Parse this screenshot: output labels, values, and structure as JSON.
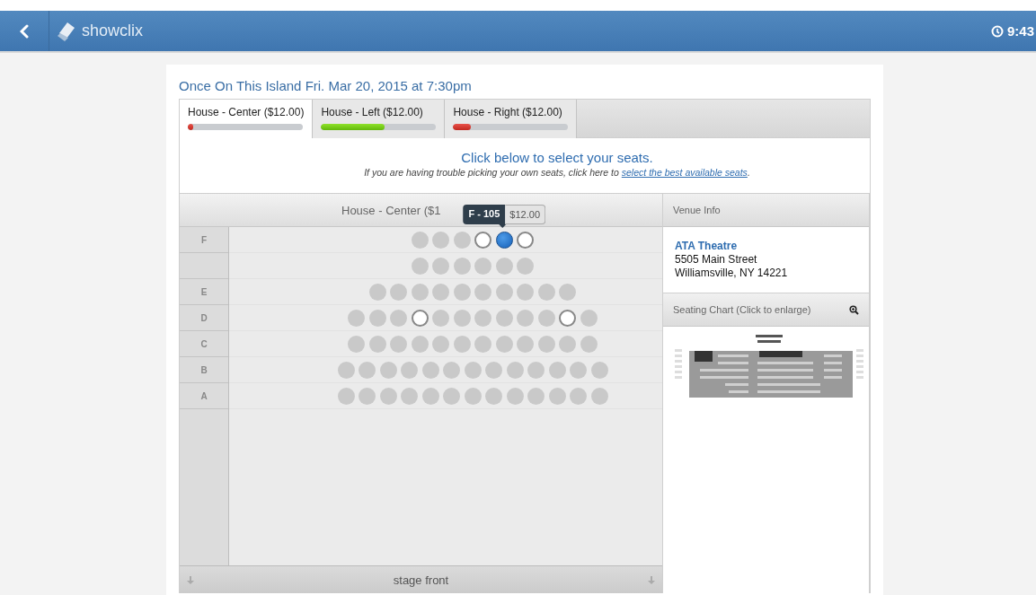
{
  "topbar": {
    "brand": "showclix",
    "time": "9:43"
  },
  "event_title": "Once On This Island Fri. Mar 20, 2015 at 7:30pm",
  "tabs": [
    {
      "label": "House - Center ($12.00)",
      "selected": true,
      "level": 0.05
    },
    {
      "label": "House - Left ($12.00)",
      "selected": false,
      "level": 0.55
    },
    {
      "label": "House - Right ($12.00)",
      "selected": false,
      "level": 0.15
    }
  ],
  "prompt": "Click below to select your seats.",
  "instructions": {
    "before": "If you are having trouble picking your own seats, click here to ",
    "link": "select the best available seats",
    "after": "."
  },
  "seat_map": {
    "header": "House - Center ($1",
    "tooltip": {
      "seat": "F - 105",
      "price": "$12.00"
    },
    "rows": [
      {
        "label": "F",
        "seats": [
          {
            "available": false,
            "selected": false
          },
          {
            "available": false,
            "selected": false
          },
          {
            "available": false,
            "selected": false
          },
          {
            "available": true,
            "selected": false
          },
          {
            "available": true,
            "selected": true
          },
          {
            "available": true,
            "selected": false
          }
        ]
      },
      {
        "label": "",
        "seats": [
          {
            "available": false,
            "selected": false
          },
          {
            "available": false,
            "selected": false
          },
          {
            "available": false,
            "selected": false
          },
          {
            "available": false,
            "selected": false
          },
          {
            "available": false,
            "selected": false
          },
          {
            "available": false,
            "selected": false
          }
        ]
      },
      {
        "label": "E",
        "seats": [
          {
            "available": false,
            "selected": false
          },
          {
            "available": false,
            "selected": false
          },
          {
            "available": false,
            "selected": false
          },
          {
            "available": false,
            "selected": false
          },
          {
            "available": false,
            "selected": false
          },
          {
            "available": false,
            "selected": false
          },
          {
            "available": false,
            "selected": false
          },
          {
            "available": false,
            "selected": false
          },
          {
            "available": false,
            "selected": false
          },
          {
            "available": false,
            "selected": false
          }
        ]
      },
      {
        "label": "D",
        "seats": [
          {
            "available": false,
            "selected": false
          },
          {
            "available": false,
            "selected": false
          },
          {
            "available": false,
            "selected": false
          },
          {
            "available": true,
            "selected": false
          },
          {
            "available": false,
            "selected": false
          },
          {
            "available": false,
            "selected": false
          },
          {
            "available": false,
            "selected": false
          },
          {
            "available": false,
            "selected": false
          },
          {
            "available": false,
            "selected": false
          },
          {
            "available": false,
            "selected": false
          },
          {
            "available": true,
            "selected": false
          },
          {
            "available": false,
            "selected": false
          }
        ]
      },
      {
        "label": "C",
        "seats": [
          {
            "available": false,
            "selected": false
          },
          {
            "available": false,
            "selected": false
          },
          {
            "available": false,
            "selected": false
          },
          {
            "available": false,
            "selected": false
          },
          {
            "available": false,
            "selected": false
          },
          {
            "available": false,
            "selected": false
          },
          {
            "available": false,
            "selected": false
          },
          {
            "available": false,
            "selected": false
          },
          {
            "available": false,
            "selected": false
          },
          {
            "available": false,
            "selected": false
          },
          {
            "available": false,
            "selected": false
          },
          {
            "available": false,
            "selected": false
          }
        ]
      },
      {
        "label": "B",
        "seats": [
          {
            "available": false,
            "selected": false
          },
          {
            "available": false,
            "selected": false
          },
          {
            "available": false,
            "selected": false
          },
          {
            "available": false,
            "selected": false
          },
          {
            "available": false,
            "selected": false
          },
          {
            "available": false,
            "selected": false
          },
          {
            "available": false,
            "selected": false
          },
          {
            "available": false,
            "selected": false
          },
          {
            "available": false,
            "selected": false
          },
          {
            "available": false,
            "selected": false
          },
          {
            "available": false,
            "selected": false
          },
          {
            "available": false,
            "selected": false
          },
          {
            "available": false,
            "selected": false
          }
        ]
      },
      {
        "label": "A",
        "seats": [
          {
            "available": false,
            "selected": false
          },
          {
            "available": false,
            "selected": false
          },
          {
            "available": false,
            "selected": false
          },
          {
            "available": false,
            "selected": false
          },
          {
            "available": false,
            "selected": false
          },
          {
            "available": false,
            "selected": false
          },
          {
            "available": false,
            "selected": false
          },
          {
            "available": false,
            "selected": false
          },
          {
            "available": false,
            "selected": false
          },
          {
            "available": false,
            "selected": false
          },
          {
            "available": false,
            "selected": false
          },
          {
            "available": false,
            "selected": false
          },
          {
            "available": false,
            "selected": false
          }
        ]
      }
    ],
    "footer": "stage front"
  },
  "venue": {
    "header": "Venue Info",
    "name": "ATA Theatre",
    "address_lines": [
      "5505 Main Street",
      "Williamsville, NY 14221"
    ],
    "chart_header": "Seating Chart (Click to enlarge)"
  }
}
